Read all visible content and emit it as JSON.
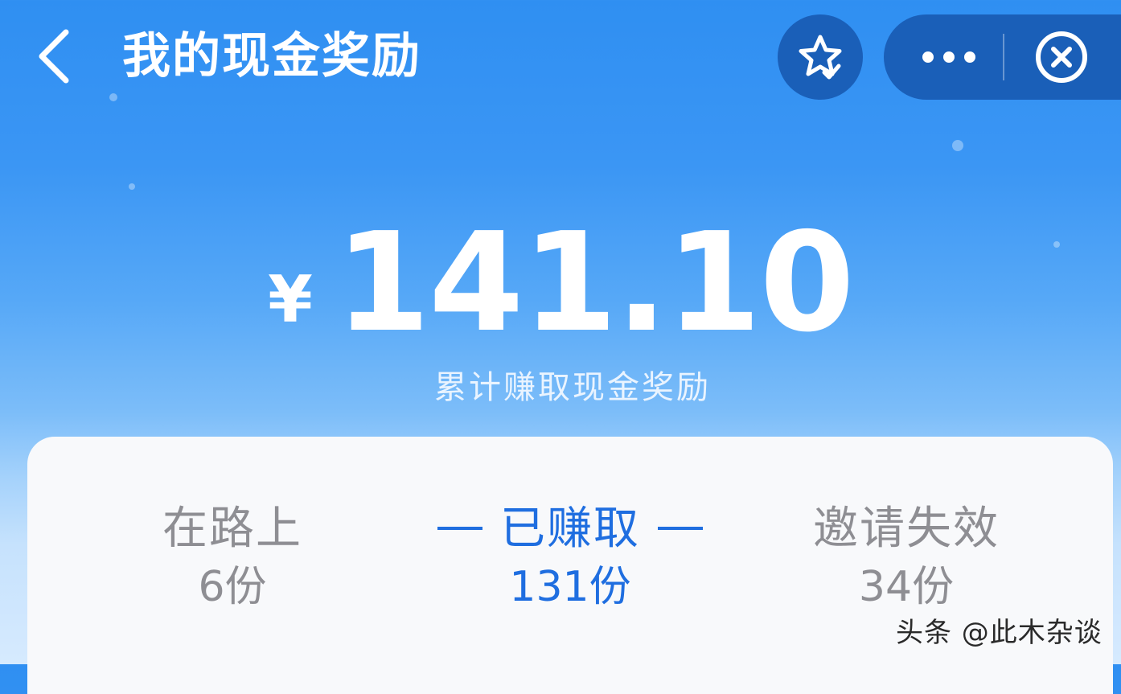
{
  "header": {
    "title": "我的现金奖励",
    "back_icon": "chevron-left-icon",
    "favorite_icon": "star-icon",
    "more_icon": "more-dots-icon",
    "close_icon": "close-circle-icon"
  },
  "summary": {
    "currency": "¥",
    "amount": "141.10",
    "label": "累计赚取现金奖励"
  },
  "tabs": [
    {
      "label": "在路上",
      "count": "6份",
      "active": false
    },
    {
      "label": "已赚取",
      "count": "131份",
      "active": true
    },
    {
      "label": "邀请失效",
      "count": "34份",
      "active": false
    }
  ],
  "watermark": "头条 @此木杂谈",
  "colors": {
    "header_bg_top": "#2f8ff2",
    "header_bg_bottom": "#d6eafe",
    "capsule_bg": "#1a5fb8",
    "active_tab": "#1f6ee0",
    "inactive_tab": "#8e8e93",
    "card_bg": "#f8f9fb"
  }
}
